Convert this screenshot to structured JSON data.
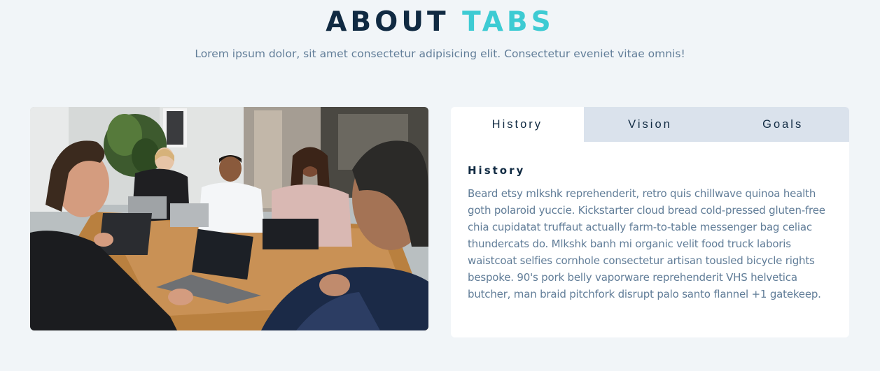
{
  "header": {
    "title_main": "ABOUT",
    "title_accent": "TABS",
    "subtitle": "Lorem ipsum dolor, sit amet consectetur adipisicing elit. Consectetur eveniet vitae omnis!"
  },
  "image": {
    "subject": "team-meeting-photo"
  },
  "tabs": {
    "items": [
      {
        "label": "History",
        "active": true
      },
      {
        "label": "Vision",
        "active": false
      },
      {
        "label": "Goals",
        "active": false
      }
    ],
    "content": {
      "heading": "History",
      "text": "Beard etsy mlkshk reprehenderit, retro quis chillwave quinoa health goth polaroid yuccie. Kickstarter cloud bread cold-pressed gluten-free chia cupidatat truffaut actually farm-to-table messenger bag celiac thundercats do. Mlkshk banh mi organic velit food truck laboris waistcoat selfies cornhole consectetur artisan tousled bicycle rights bespoke. 90's pork belly vaporware reprehenderit VHS helvetica butcher, man braid pitchfork disrupt palo santo flannel +1 gatekeep."
    }
  },
  "colors": {
    "background": "#f1f5f8",
    "primary_dark": "#102a42",
    "accent": "#3dcbd3",
    "muted_text": "#617d98",
    "tab_inactive_bg": "#dae2ec",
    "card_bg": "#ffffff"
  }
}
